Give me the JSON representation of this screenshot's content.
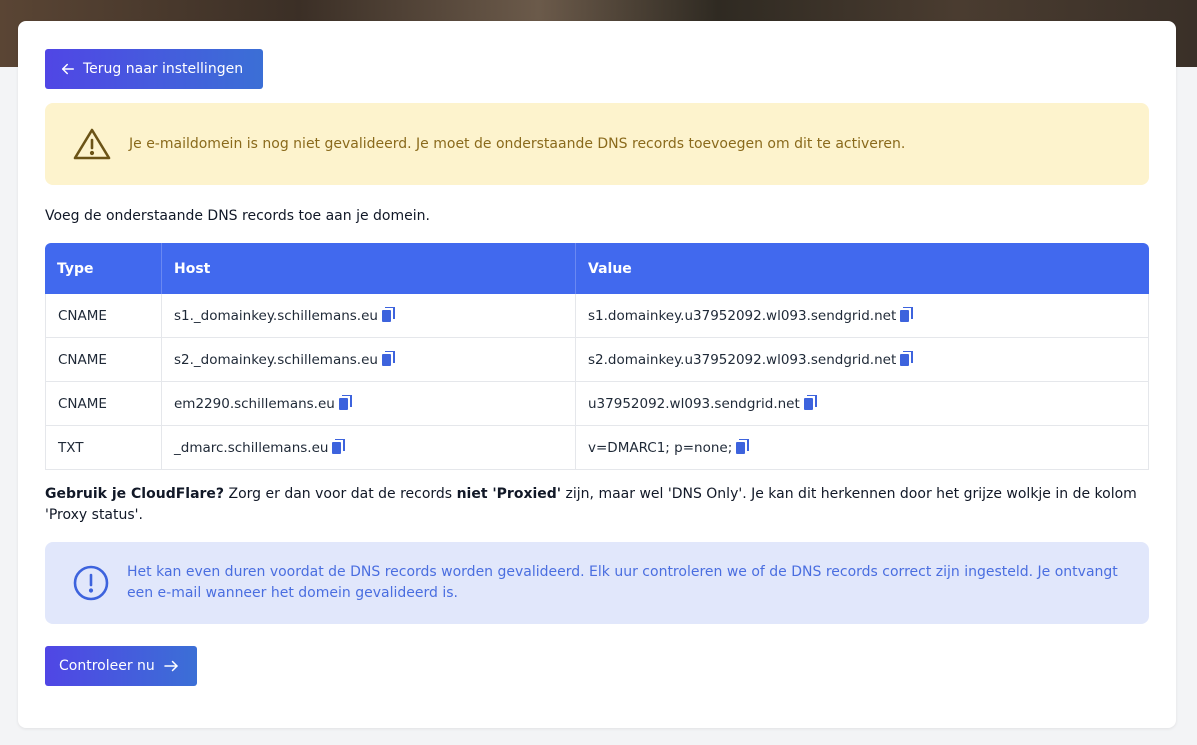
{
  "colors": {
    "primary": "#4169ee",
    "button_gradient_start": "#5046e5",
    "button_gradient_end": "#3b6fd6",
    "warning_bg": "#fdf3cd",
    "warning_text": "#8a6a1c",
    "info_bg": "#e1e7fb",
    "info_text": "#4a6ee0"
  },
  "back_button": {
    "label": "Terug naar instellingen",
    "icon": "arrow-left-icon"
  },
  "warning": {
    "icon": "warning-triangle-icon",
    "text": "Je e-maildomein is nog niet gevalideerd. Je moet de onderstaande DNS records toevoegen om dit te activeren."
  },
  "intro": "Voeg de onderstaande DNS records toe aan je domein.",
  "table": {
    "headers": {
      "type": "Type",
      "host": "Host",
      "value": "Value"
    },
    "rows": [
      {
        "type": "CNAME",
        "host": "s1._domainkey.schillemans.eu",
        "value": "s1.domainkey.u37952092.wl093.sendgrid.net"
      },
      {
        "type": "CNAME",
        "host": "s2._domainkey.schillemans.eu",
        "value": "s2.domainkey.u37952092.wl093.sendgrid.net"
      },
      {
        "type": "CNAME",
        "host": "em2290.schillemans.eu",
        "value": "u37952092.wl093.sendgrid.net"
      },
      {
        "type": "TXT",
        "host": "_dmarc.schillemans.eu",
        "value": "v=DMARC1; p=none;"
      }
    ],
    "copy_icon": "copy-icon"
  },
  "cloudflare": {
    "bold_1": "Gebruik je CloudFlare?",
    "text_1": " Zorg er dan voor dat de records ",
    "bold_2": "niet 'Proxied'",
    "text_2": " zijn, maar wel 'DNS Only'. Je kan dit herkennen door het grijze wolkje in de kolom 'Proxy status'."
  },
  "info": {
    "icon": "exclamation-circle-icon",
    "text": "Het kan even duren voordat de DNS records worden gevalideerd. Elk uur controleren we of de DNS records correct zijn ingesteld. Je ontvangt een e-mail wanneer het domein gevalideerd is."
  },
  "check_button": {
    "label": "Controleer nu",
    "icon": "arrow-right-icon"
  }
}
